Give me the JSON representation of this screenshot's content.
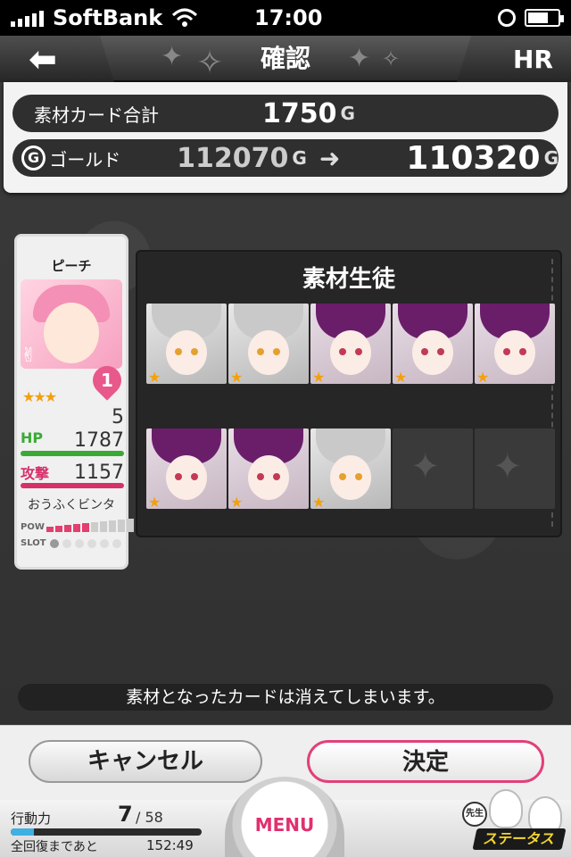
{
  "status_bar": {
    "carrier": "SoftBank",
    "time": "17:00"
  },
  "header": {
    "title": "確認",
    "right_label": "HR"
  },
  "summary": {
    "material_total_label": "素材カード合計",
    "material_total_value": "1750",
    "gold_label": "ゴールド",
    "gold_before": "112070",
    "gold_after": "110320",
    "unit": "G",
    "gold_icon": "G"
  },
  "character": {
    "name": "ピーチ",
    "stars": "★★★",
    "affection": "1",
    "level": "5",
    "hp_label": "HP",
    "hp_value": "1787",
    "attack_label": "攻撃",
    "attack_value": "1157",
    "skill": "おうふくビンタ",
    "pow_label": "POW",
    "slot_label": "SLOT"
  },
  "materials": {
    "title": "素材生徒",
    "cards": [
      {
        "type": "silver",
        "stars": "★"
      },
      {
        "type": "silver",
        "stars": "★"
      },
      {
        "type": "purple",
        "stars": "★"
      },
      {
        "type": "purple",
        "stars": "★"
      },
      {
        "type": "purple",
        "stars": "★"
      },
      {
        "type": "purple",
        "stars": "★"
      },
      {
        "type": "purple",
        "stars": "★"
      },
      {
        "type": "silver",
        "stars": "★"
      },
      {
        "type": "empty",
        "stars": ""
      },
      {
        "type": "empty",
        "stars": ""
      }
    ]
  },
  "notice": "素材となったカードは消えてしまいます。",
  "buttons": {
    "cancel": "キャンセル",
    "confirm": "決定"
  },
  "footer": {
    "ap_label": "行動力",
    "ap_current": "7",
    "ap_max": "/ 58",
    "ap_fraction": 0.12,
    "recover_label": "全回復まであと",
    "recover_time": "152:49",
    "menu_label": "MENU",
    "status_label": "ステータス",
    "sensei_label": "先生"
  },
  "colors": {
    "accent_pink": "#e2407a",
    "gold_star": "#f2a010",
    "hp_green": "#3aaa35"
  }
}
